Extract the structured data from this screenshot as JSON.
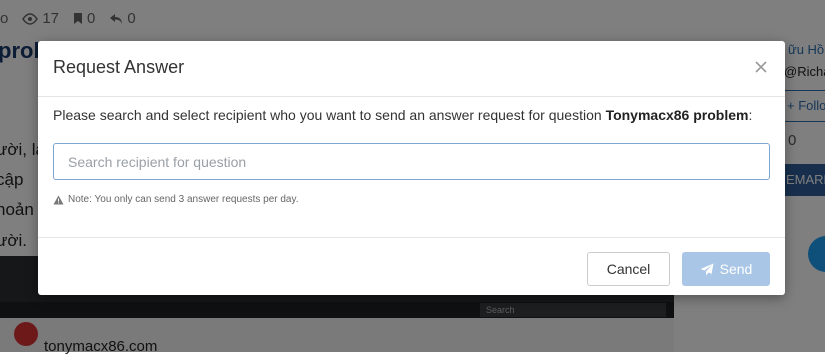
{
  "background": {
    "stats": {
      "prefix": "o",
      "views": "17",
      "bookmarks": "0",
      "shares": "0"
    },
    "title_fragment": "prob",
    "text_lines": [
      "ười, lại",
      "cập",
      "hoản",
      "ười."
    ],
    "right_panel": {
      "author_fragment": "ữu Hồ",
      "handle_fragment": "@Richar",
      "follow_fragment": "+ Follo",
      "count": "0",
      "mark_fragment": "EMARK"
    },
    "embedded_screenshot": {
      "search_label": "Search",
      "site_fragment": "tonymacx86.com"
    }
  },
  "modal": {
    "title": "Request Answer",
    "description_prefix": "Please search and select recipient who you want to send an answer request for question ",
    "question_title": "Tonymacx86 problem",
    "description_suffix": ":",
    "search": {
      "placeholder": "Search recipient for question",
      "value": ""
    },
    "note": "Note: You only can send 3 answer requests per day.",
    "cancel_label": "Cancel",
    "send_label": "Send"
  },
  "colors": {
    "overlay": "rgba(0,0,0,0.5)",
    "send_disabled": "#a9c6e6",
    "input_focus_border": "#7ea6cf"
  }
}
